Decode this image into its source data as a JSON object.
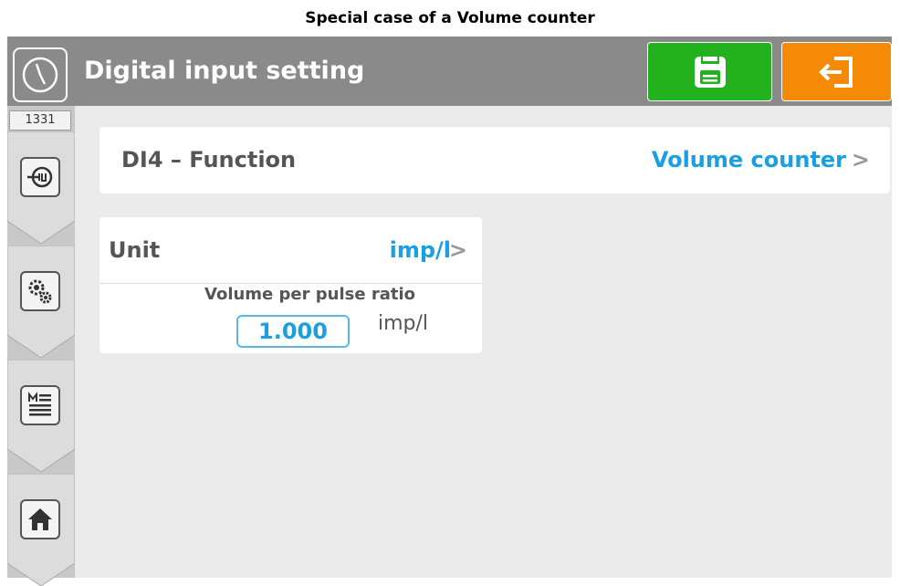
{
  "caption": "Special case of a Volume counter",
  "header": {
    "title": "Digital input setting",
    "clock_icon": "clock-icon",
    "save_icon": "floppy-disk-icon",
    "exit_icon": "exit-arrow-icon",
    "bg_color": "#8a8a8a",
    "save_color": "#23b21e",
    "exit_color": "#f58a07"
  },
  "sidebar": {
    "id": "1331",
    "items": [
      {
        "icon": "input-plug-icon"
      },
      {
        "icon": "settings-gears-icon"
      },
      {
        "icon": "menu-list-icon"
      },
      {
        "icon": "home-icon"
      }
    ]
  },
  "function": {
    "label": "DI4 – Function",
    "value": "Volume counter",
    "chevron": ">"
  },
  "unit": {
    "label": "Unit",
    "value": "imp/l",
    "chevron": ">",
    "ratio_label": "Volume per pulse ratio",
    "ratio_value": "1.000",
    "ratio_unit": "imp/l"
  },
  "accent_color": "#1aa0e0"
}
